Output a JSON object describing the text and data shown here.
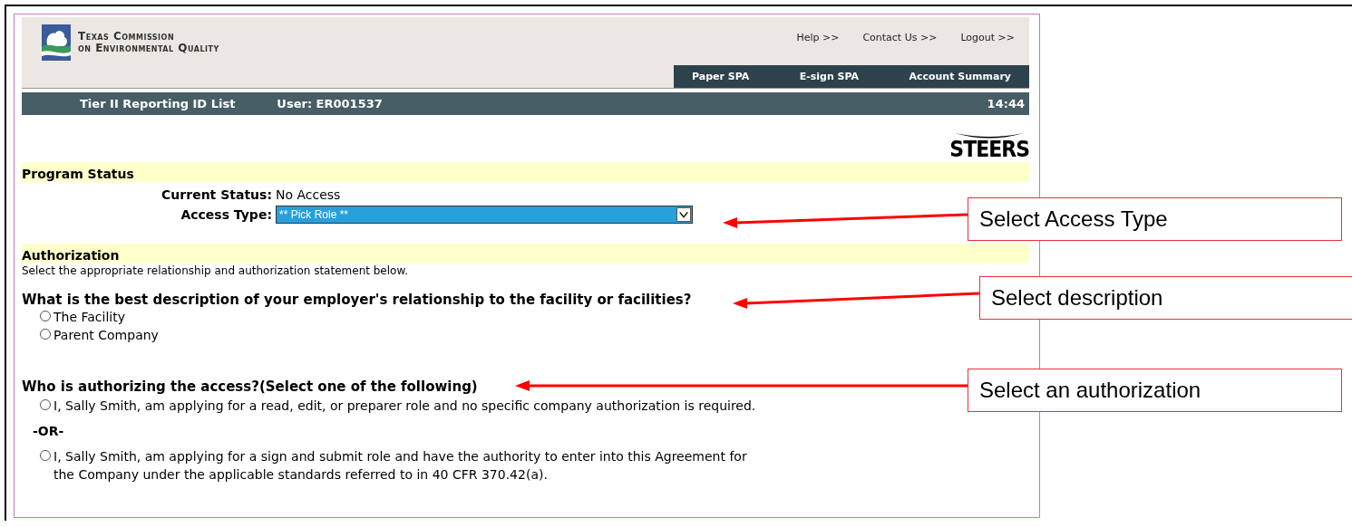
{
  "header": {
    "agency_name": [
      "Texas Commission",
      "on Environmental Quality"
    ],
    "links": [
      "Help >>",
      "Contact Us >>",
      "Logout >>"
    ],
    "nav": [
      "Paper SPA",
      "E-sign SPA",
      "Account Summary"
    ]
  },
  "title_bar": {
    "page": "Tier II Reporting ID List",
    "user": "User: ER001537",
    "time": "14:44"
  },
  "app_logo": "STEERS",
  "program_status": {
    "heading": "Program Status",
    "fields": [
      {
        "kind": "text",
        "label": "Current Status:",
        "value": "No Access"
      },
      {
        "kind": "select",
        "label": "Access Type:",
        "value": "** Pick Role **",
        "focused": true
      }
    ]
  },
  "authorization": {
    "heading": "Authorization",
    "intro": "Select the appropriate relationship and authorization statement below.",
    "questions": [
      {
        "question": "What is the best description of your employer's relationship to the facility or facilities?",
        "options": [
          {
            "kind": "radio",
            "label": "The Facility",
            "selected": false
          },
          {
            "kind": "radio",
            "label": "Parent Company",
            "selected": false
          }
        ]
      },
      {
        "question": "Who is authorizing the access?(Select one of the following)",
        "options": [
          {
            "kind": "radio",
            "label": "I, Sally Smith, am applying for a read, edit, or preparer role and no specific company authorization is required.",
            "selected": false
          },
          {
            "kind": "separator",
            "label": "-OR-"
          },
          {
            "kind": "radio",
            "label": "I, Sally Smith, am applying for a sign and submit role and have the authority to enter into this Agreement for the Company under the applicable standards referred to in 40 CFR 370.42(a).",
            "selected": false
          }
        ]
      }
    ]
  },
  "callouts": [
    {
      "text": "Select Access Type"
    },
    {
      "text": "Select description"
    },
    {
      "text": "Select an authorization"
    }
  ]
}
